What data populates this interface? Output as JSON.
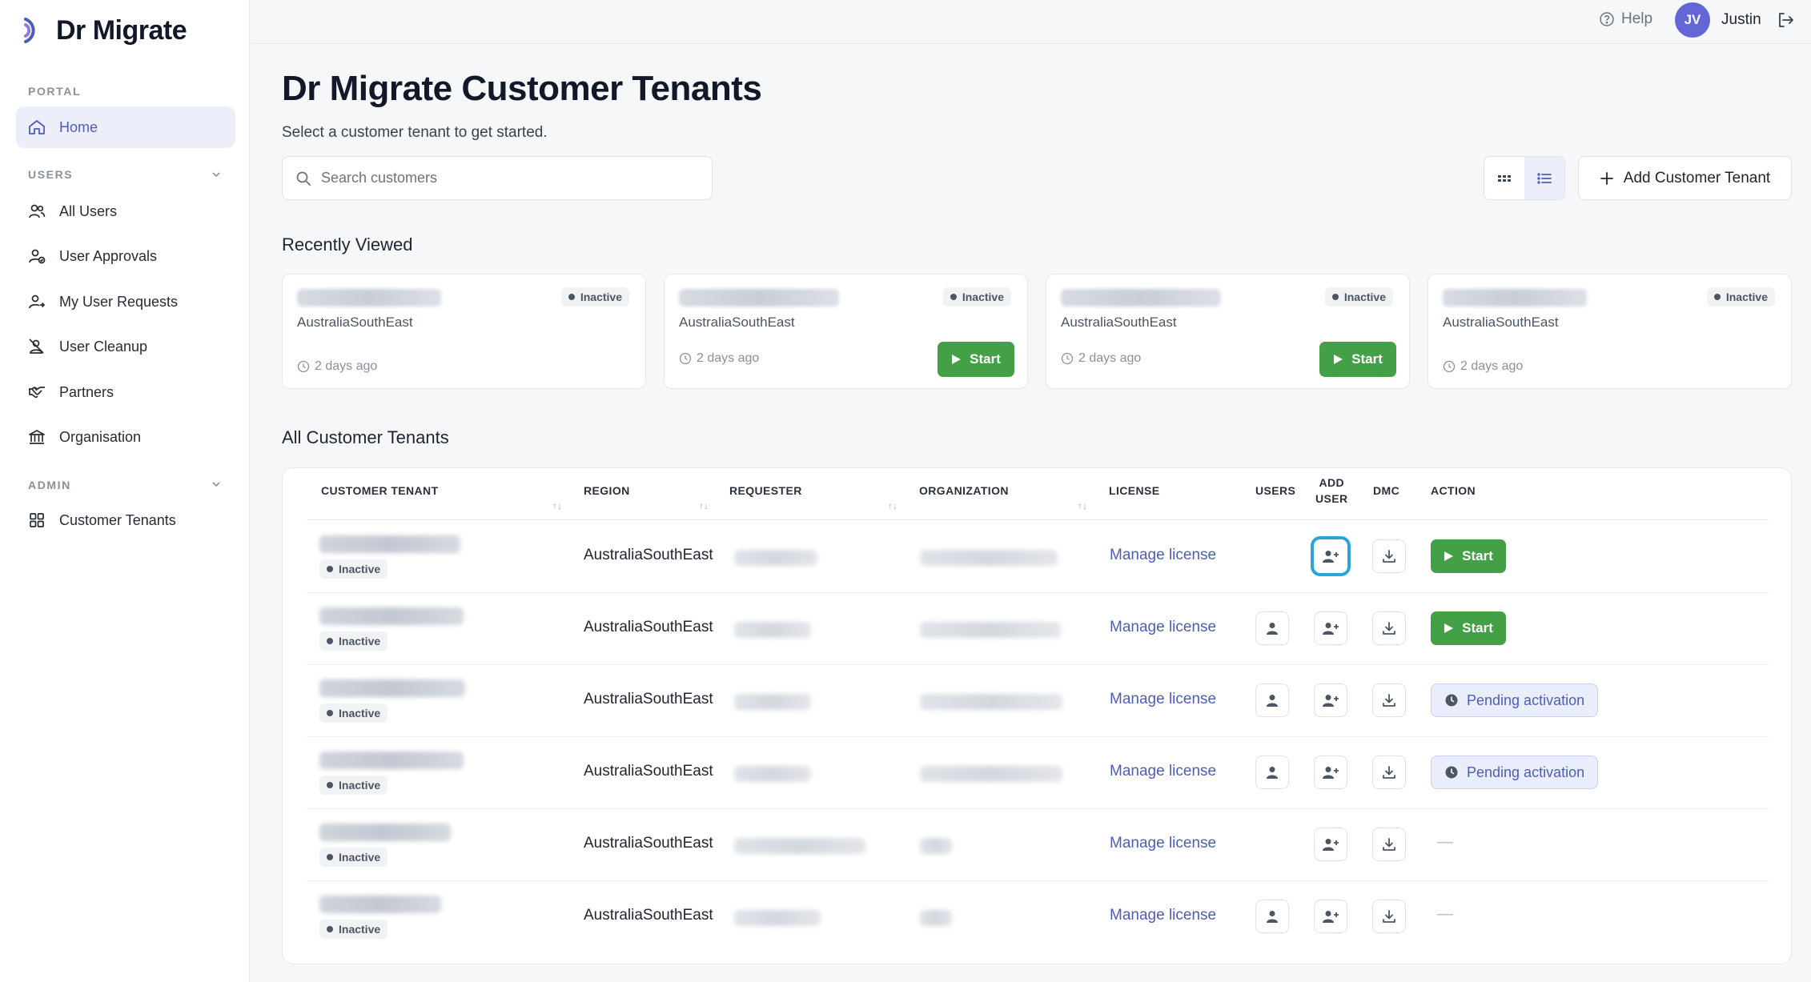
{
  "brand": {
    "name": "Dr Migrate"
  },
  "sidebar": {
    "portal_label": "PORTAL",
    "users_label": "USERS",
    "admin_label": "ADMIN",
    "home": "Home",
    "users_items": [
      "All Users",
      "User Approvals",
      "My User Requests",
      "User Cleanup",
      "Partners",
      "Organisation"
    ],
    "admin_items": [
      "Customer Tenants"
    ]
  },
  "topbar": {
    "help": "Help",
    "avatar_initials": "JV",
    "username": "Justin"
  },
  "main": {
    "title": "Dr Migrate Customer Tenants",
    "subtitle": "Select a customer tenant to get started.",
    "search_placeholder": "Search customers",
    "add_button": "Add Customer Tenant",
    "recent_title": "Recently Viewed",
    "all_title": "All Customer Tenants"
  },
  "recent_cards": [
    {
      "region": "AustraliaSouthEast",
      "status": "Inactive",
      "time": "2 days ago",
      "has_start": false
    },
    {
      "region": "AustraliaSouthEast",
      "status": "Inactive",
      "time": "2 days ago",
      "has_start": true
    },
    {
      "region": "AustraliaSouthEast",
      "status": "Inactive",
      "time": "2 days ago",
      "has_start": true
    },
    {
      "region": "AustraliaSouthEast",
      "status": "Inactive",
      "time": "2 days ago",
      "has_start": false
    }
  ],
  "start_label": "Start",
  "table": {
    "columns": {
      "tenant": "CUSTOMER TENANT",
      "region": "REGION",
      "requester": "REQUESTER",
      "organization": "ORGANIZATION",
      "license": "LICENSE",
      "users": "USERS",
      "add_user_1": "ADD",
      "add_user_2": "USER",
      "dmc": "DMC",
      "action": "ACTION"
    },
    "manage_license": "Manage license",
    "pending_label": "Pending activation",
    "dash": "—",
    "rows": [
      {
        "status": "Inactive",
        "region": "AustraliaSouthEast",
        "has_users": false,
        "action": "start"
      },
      {
        "status": "Inactive",
        "region": "AustraliaSouthEast",
        "has_users": true,
        "action": "start"
      },
      {
        "status": "Inactive",
        "region": "AustraliaSouthEast",
        "has_users": true,
        "action": "pending"
      },
      {
        "status": "Inactive",
        "region": "AustraliaSouthEast",
        "has_users": true,
        "action": "pending"
      },
      {
        "status": "Inactive",
        "region": "AustraliaSouthEast",
        "has_users": false,
        "action": "none"
      },
      {
        "status": "Inactive",
        "region": "AustraliaSouthEast",
        "has_users": true,
        "action": "none"
      }
    ]
  },
  "colors": {
    "accent": "#4d5db9",
    "start_green": "#43a047",
    "avatar": "#6366d6",
    "focus": "#2aa4dc"
  }
}
